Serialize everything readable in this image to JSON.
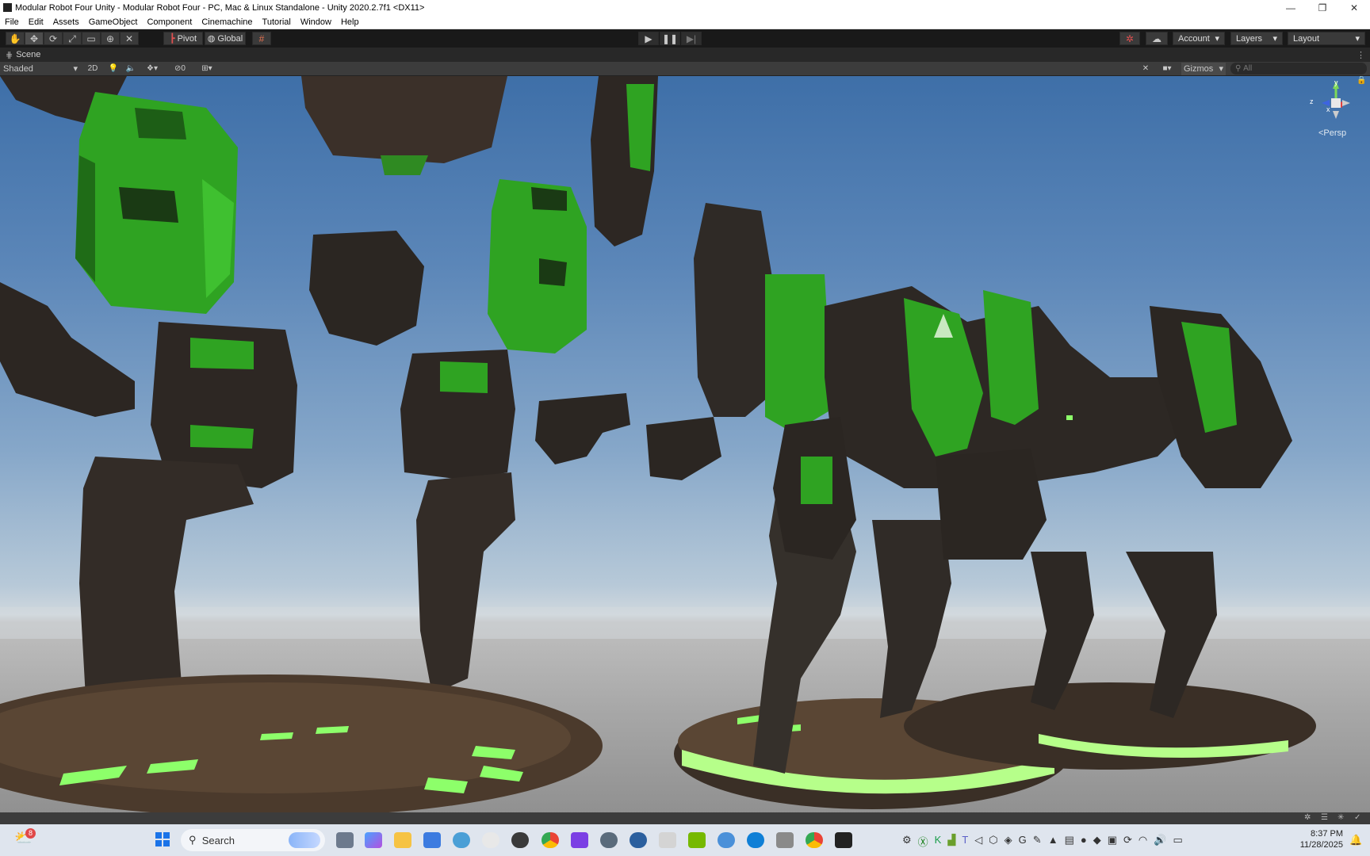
{
  "window": {
    "title": "Modular Robot Four Unity - Modular Robot Four - PC, Mac & Linux Standalone - Unity 2020.2.7f1 <DX11>",
    "controls": [
      "—",
      "❐",
      "✕"
    ]
  },
  "menu": [
    "File",
    "Edit",
    "Assets",
    "GameObject",
    "Component",
    "Cinemachine",
    "Tutorial",
    "Window",
    "Help"
  ],
  "toolbar": {
    "tools": [
      "hand-tool",
      "move-tool",
      "rotate-tool",
      "scale-tool",
      "rect-tool",
      "transform-tool",
      "custom-tool"
    ],
    "pivot_label": "Pivot",
    "global_label": "Global",
    "account_label": "Account",
    "layers_label": "Layers",
    "layout_label": "Layout"
  },
  "scene_tab": {
    "label": "Scene"
  },
  "scene_toolbar": {
    "shading_mode": "Shaded",
    "mode_2d": "2D",
    "hidden_count": "0",
    "gizmos_label": "Gizmos",
    "search_placeholder": "All"
  },
  "gizmo": {
    "axis_y": "y",
    "axis_z": "z",
    "axis_x": "x",
    "projection": "<Persp"
  },
  "taskbar": {
    "notification_badge": "8",
    "search_placeholder": "Search",
    "time": "8:37 PM",
    "date": "11/28/2025"
  },
  "colors": {
    "accent_green": "#36c62c",
    "glow_green": "#8dff6a",
    "sky_top": "#3e6fa8",
    "ground": "#a8a8a8"
  }
}
